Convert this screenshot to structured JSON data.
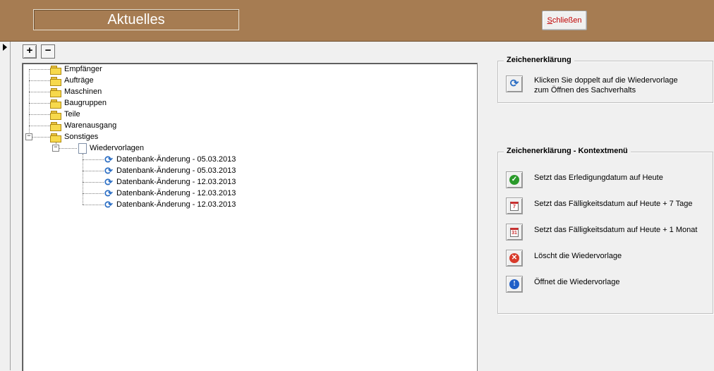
{
  "header": {
    "title": "Aktuelles",
    "close_label_first": "S",
    "close_label_rest": "chließen"
  },
  "toolbar": {
    "expand_label": "+",
    "collapse_label": "−"
  },
  "tree": {
    "items": [
      {
        "label": "Empfänger"
      },
      {
        "label": "Aufträge"
      },
      {
        "label": "Maschinen"
      },
      {
        "label": "Baugruppen"
      },
      {
        "label": "Teile"
      },
      {
        "label": "Warenausgang"
      },
      {
        "label": "Sonstiges"
      }
    ],
    "sub": {
      "label": "Wiedervorlagen"
    },
    "entries": [
      {
        "label": "Datenbank-Änderung - 05.03.2013"
      },
      {
        "label": "Datenbank-Änderung - 05.03.2013"
      },
      {
        "label": "Datenbank-Änderung - 12.03.2013"
      },
      {
        "label": "Datenbank-Änderung - 12.03.2013"
      },
      {
        "label": "Datenbank-Änderung - 12.03.2013"
      }
    ]
  },
  "legend": {
    "title": "Zeichenerklärung",
    "line1": "Klicken Sie doppelt auf die Wiedervorlage",
    "line2": "zum Öffnen des Sachverhalts"
  },
  "context_legend": {
    "title": "Zeichenerklärung - Kontextmenü",
    "items": [
      {
        "text": "Setzt das Erledigungdatum auf Heute",
        "icon": "check-icon"
      },
      {
        "text": "Setzt das Fälligkeitsdatum auf Heute + 7 Tage",
        "icon": "calendar-7-icon"
      },
      {
        "text": "Setzt das Fälligkeitsdatum auf Heute + 1 Monat",
        "icon": "calendar-31-icon"
      },
      {
        "text": "Löscht die Wiedervorlage",
        "icon": "delete-icon"
      },
      {
        "text": "Öffnet die Wiedervorlage",
        "icon": "info-icon"
      }
    ],
    "cal7_label": "7",
    "cal31_label": "31"
  },
  "colors": {
    "header_bg": "#a67c52",
    "close_text": "#c00000"
  }
}
